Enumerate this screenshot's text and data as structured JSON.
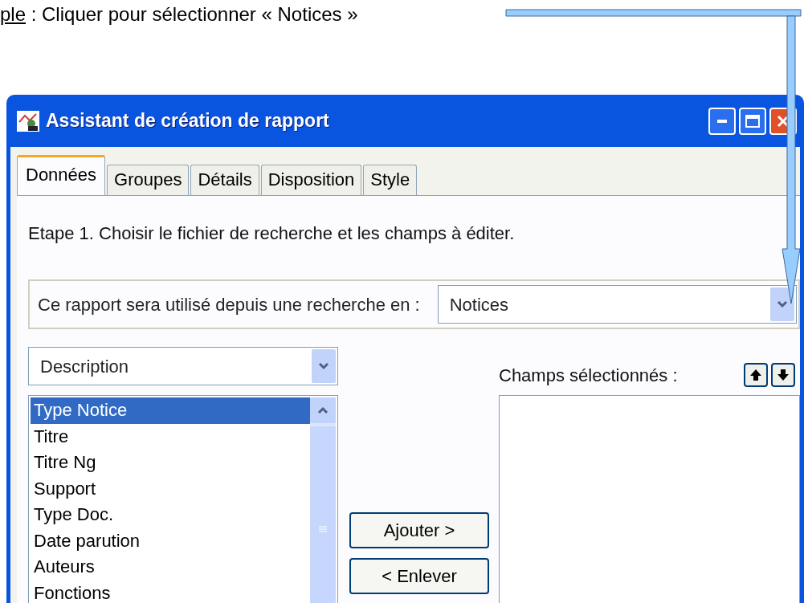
{
  "caption": {
    "lead": "ple",
    "text": " : Cliquer pour sélectionner « Notices »"
  },
  "window": {
    "title": "Assistant de création de rapport"
  },
  "tabs": [
    {
      "label": "Données",
      "selected": true
    },
    {
      "label": "Groupes",
      "selected": false
    },
    {
      "label": "Détails",
      "selected": false
    },
    {
      "label": "Disposition",
      "selected": false
    },
    {
      "label": "Style",
      "selected": false
    }
  ],
  "step_text": "Etape 1. Choisir le fichier de recherche et les champs à éditer.",
  "search_source": {
    "label": "Ce rapport sera utilisé depuis une recherche en :",
    "value": "Notices"
  },
  "category_select": {
    "value": "Description"
  },
  "available_fields": [
    {
      "label": "Type Notice",
      "selected": true
    },
    {
      "label": "Titre",
      "selected": false
    },
    {
      "label": "Titre Ng",
      "selected": false
    },
    {
      "label": "Support",
      "selected": false
    },
    {
      "label": "Type Doc.",
      "selected": false
    },
    {
      "label": "Date parution",
      "selected": false
    },
    {
      "label": "Auteurs",
      "selected": false
    },
    {
      "label": "Fonctions",
      "selected": false
    }
  ],
  "buttons": [
    "Ajouter >",
    "< Enlever"
  ],
  "selected_fields": {
    "label": "Champs sélectionnés :"
  }
}
